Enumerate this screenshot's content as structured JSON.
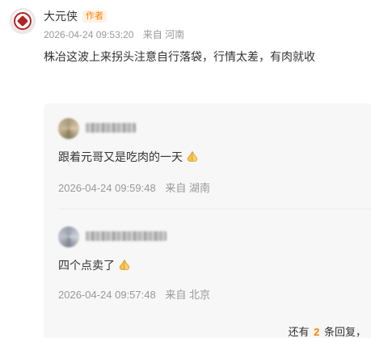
{
  "post": {
    "author": "大元侠",
    "badge": "作者",
    "timestamp": "2026-04-24 09:53:20",
    "location": "来自 河南",
    "content": "株冶这波上来拐头注意自行落袋，行情太差，有肉就收"
  },
  "replies": [
    {
      "text": "跟着元哥又是吃肉的一天",
      "emoji": "praying-hands-icon",
      "timestamp": "2026-04-24 09:59:48",
      "location": "来自 湖南"
    },
    {
      "text": "四个点卖了",
      "emoji": "praying-hands-icon",
      "timestamp": "2026-04-24 09:57:48",
      "location": "来自 北京"
    }
  ],
  "more_replies": {
    "prefix": "还有",
    "count": "2",
    "suffix": "条回复，"
  },
  "colors": {
    "accent": "#ff8200",
    "meta": "#999999",
    "panel": "#f7f7f7"
  }
}
